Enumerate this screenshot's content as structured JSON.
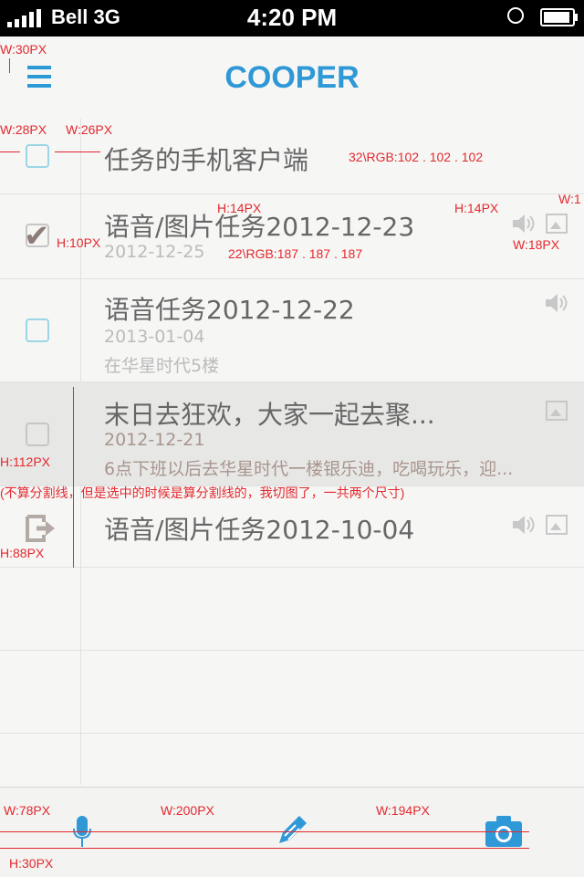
{
  "status": {
    "carrier": "Bell 3G",
    "time": "4:20 PM"
  },
  "header": {
    "title": "COOPER"
  },
  "tasks": [
    {
      "title": "任务的手机客户端"
    },
    {
      "title": "语音/图片任务2012-12-23",
      "date": "2012-12-25"
    },
    {
      "title": "语音任务2012-12-22",
      "date": "2013-01-04",
      "note": "在华星时代5楼"
    },
    {
      "title": "末日去狂欢，大家一起去聚...",
      "date": "2012-12-21",
      "note": "6点下班以后去华星时代一楼银乐迪，吃喝玩乐，迎..."
    },
    {
      "title": "语音/图片任务2012-10-04"
    }
  ],
  "annotations": {
    "a1": "W:30PX",
    "a2": "W:28PX",
    "a3": "W:26PX",
    "a4": "32\\RGB:102 . 102 . 102",
    "a5": "H:14PX",
    "a6": "H:14PX",
    "a7": "W:1",
    "a8": "H:10PX",
    "a9": "22\\RGB:187 . 187 . 187",
    "a10": "W:18PX",
    "a11": "H:112PX",
    "a12": "(不算分割线，但是选中的时候是算分割线的，我切图了，一共两个尺寸)",
    "a13": "H:88PX",
    "a14": "W:78PX",
    "a15": "W:200PX",
    "a16": "W:194PX",
    "a17": "H:30PX"
  },
  "colors": {
    "accent": "#2f98d6",
    "title_text": "#666666",
    "sub_text": "#bbbbbb",
    "annotation": "#e4292e"
  },
  "icons": [
    "menu-icon",
    "checkbox-icon",
    "speaker-icon",
    "image-icon",
    "exit-icon",
    "microphone-icon",
    "pen-icon",
    "camera-icon"
  ]
}
